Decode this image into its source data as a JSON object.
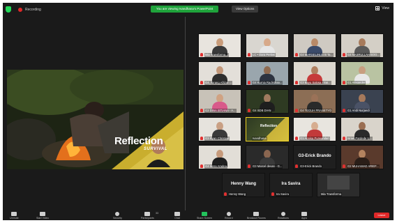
{
  "topbar": {
    "recording_label": "Recording",
    "share_banner": "You are viewing Ivandhana's PowerPoint",
    "view_options": "View Options",
    "view_label": "View"
  },
  "slide": {
    "title": "Reflection",
    "subtitle": "SURVIVAL"
  },
  "participants": [
    "Mia Transforma...",
    "LC • Dara Pertiwi",
    "G4 MARSELINUS B Ta...",
    "G4 NASRULLAH BOO...",
    "G4_Torang Afrizal ...",
    "G4 Kurnia Radisthaa...",
    "G3 Bayu Salosa - Sai...",
    "G1 Alexander",
    "G2 DINA ISTIANA - A...",
    "G4 SDB DIAN",
    "G4 TEGUH PRASETYO",
    "G1 Andi Nurjaedi",
    "G3 Ryan Christian",
    "Ivandhana",
    "G1 Annisa Purwandari",
    "Israel Pardede U...",
    "G4 Sena Aradea",
    "G3 Marcel devan - G...",
    "G3-Erick Brando",
    "G2 MUHAMAD ARIEF...",
    "Henny Wang",
    "Ira Savira",
    "Mia Transforma"
  ],
  "big_names": {
    "erick": "G3-Erick Brando",
    "henny": "Henny Wang",
    "ira": "Ira Savira"
  },
  "toolbar": {
    "unmute": "Unmute",
    "start_video": "Start Video",
    "security": "Security",
    "participants": "Participants",
    "participants_count": "33",
    "chat": "Chat",
    "share_screen": "Share Screen",
    "record": "Record",
    "breakout": "Breakout Rooms",
    "reactions": "Reactions",
    "apps": "Apps",
    "leave": "Leave"
  },
  "colors": {
    "banner": "#1fa33b",
    "active_speaker": "#f0d320",
    "leave": "#e02828"
  }
}
